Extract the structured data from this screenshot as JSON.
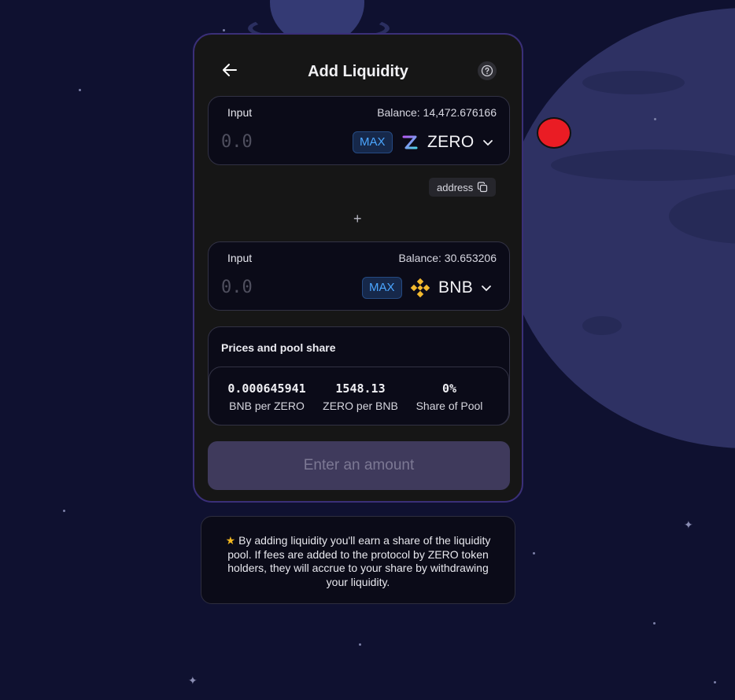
{
  "header": {
    "title": "Add Liquidity"
  },
  "token_a": {
    "label": "Input",
    "balance": "Balance: 14,472.676166",
    "placeholder": "0.0",
    "max_label": "MAX",
    "symbol": "ZERO"
  },
  "address_label": "address",
  "plus_symbol": "+",
  "token_b": {
    "label": "Input",
    "balance": "Balance: 30.653206",
    "placeholder": "0.0",
    "max_label": "MAX",
    "symbol": "BNB"
  },
  "pool": {
    "title": "Prices and pool share",
    "stats": [
      {
        "value": "0.000645941",
        "label": "BNB per ZERO"
      },
      {
        "value": "1548.13",
        "label": "ZERO per BNB"
      },
      {
        "value": "0%",
        "label": "Share of Pool"
      }
    ]
  },
  "submit_label": "Enter an amount",
  "info_text": "By adding liquidity you'll earn a share of the liquidity pool. If fees are added to the protocol by ZERO token holders, they will accrue to your share by withdrawing your liquidity.",
  "colors": {
    "background": "#0f1130",
    "card": "#161616",
    "card_border": "#3a2f78",
    "max_text": "#4ba6ff",
    "bnb_gold": "#f3ba2f",
    "star": "#f3b81f",
    "red_dot": "#ea1c24"
  },
  "icons": [
    "back-arrow-icon",
    "help-icon",
    "zero-token-icon",
    "bnb-token-icon",
    "chevron-down-icon",
    "copy-icon",
    "star-icon"
  ]
}
